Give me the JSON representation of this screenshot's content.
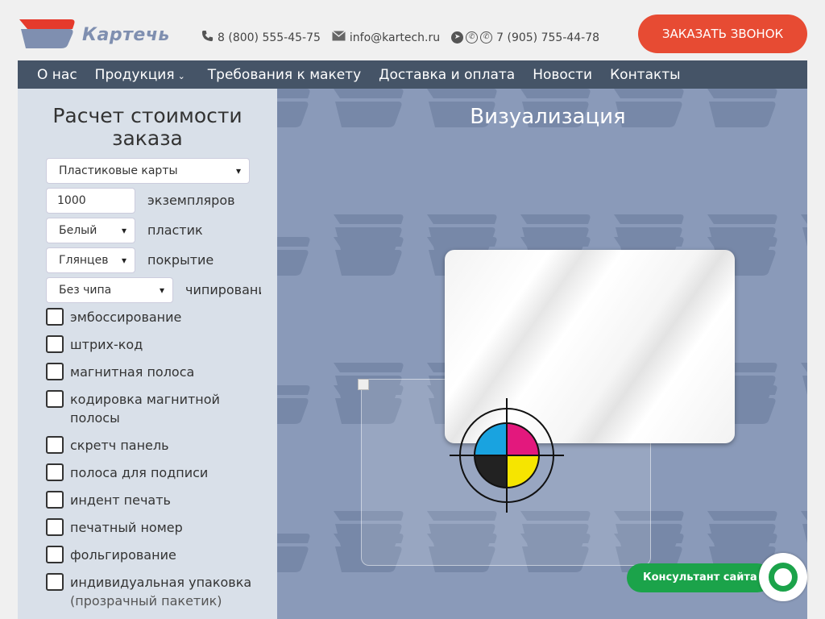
{
  "header": {
    "logo_text": "Картечь",
    "phone1": "8 (800) 555-45-75",
    "email": "info@kartech.ru",
    "phone2": "7 (905) 755-44-78",
    "cta_label": "ЗАКАЗАТЬ ЗВОНОК"
  },
  "nav": {
    "items": [
      {
        "label": "О нас"
      },
      {
        "label": "Продукция"
      },
      {
        "label": "Требования к макету"
      },
      {
        "label": "Доставка и оплата"
      },
      {
        "label": "Новости"
      },
      {
        "label": "Контакты"
      }
    ]
  },
  "calculator": {
    "title_line1": "Расчет стоимости",
    "title_line2": "заказа",
    "product_select": "Пластиковые карты",
    "quantity_value": "1000",
    "quantity_label": "экземпляров",
    "plastic_select": "Белый",
    "plastic_label": "пластик",
    "coating_select": "Глянцев",
    "coating_label": "покрытие",
    "chip_select": "Без чипа",
    "chip_label": "чипировани",
    "options": [
      {
        "label": "эмбоссирование"
      },
      {
        "label": "штрих-код"
      },
      {
        "label": "магнитная полоса"
      },
      {
        "label": "кодировка магнитной",
        "label2": "полосы"
      },
      {
        "label": "скретч панель"
      },
      {
        "label": "полоса для подписи"
      },
      {
        "label": "индент печать"
      },
      {
        "label": "печатный номер"
      },
      {
        "label": "фольгирование"
      },
      {
        "label": "индивидуальная упаковка",
        "label2": "(прозрачный пакетик)"
      }
    ]
  },
  "visualization": {
    "title": "Визуализация"
  },
  "chat": {
    "label": "Консультант сайта"
  },
  "colors": {
    "accent": "#e74b33",
    "nav_bg": "#455467",
    "panel_bg": "#d9e0e9",
    "visual_bg": "#8a9ab9",
    "chat_green": "#1ba34a"
  },
  "icons": [
    "phone-icon",
    "mail-icon",
    "telegram-icon",
    "whatsapp-icon",
    "viber-icon",
    "chevron-down-icon",
    "cmyk-target-icon",
    "chat-icon"
  ]
}
